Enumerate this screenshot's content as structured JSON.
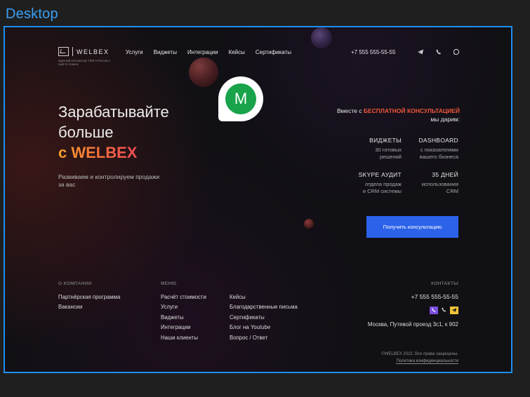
{
  "frame_label": "Desktop",
  "brand": {
    "name": "WELBEX",
    "tagline": "Крупный интегратор CRM в России и ещё 8 странах"
  },
  "nav": [
    "Услуги",
    "Виджеты",
    "Интеграции",
    "Кейсы",
    "Сертификаты"
  ],
  "header": {
    "phone": "+7 555 555-55-55",
    "icons": [
      "telegram-icon",
      "viber-icon",
      "whatsapp-icon"
    ]
  },
  "overlay_badge": {
    "letter": "M",
    "color": "#19a34a"
  },
  "hero": {
    "title_line1": "Зарабатывайте",
    "title_line2": "больше",
    "title_accent": "с WELBEX",
    "subtitle": "Развиваем и контролируем продажи за вас"
  },
  "offer": {
    "head_prefix": "Вместе с ",
    "head_highlight": "БЕСПЛАТНОЙ КОНСУЛЬТАЦИЕЙ",
    "head_suffix": " мы дарим:",
    "features": [
      {
        "title": "ВИДЖЕТЫ",
        "desc1": "30 готовых",
        "desc2": "решений"
      },
      {
        "title": "DASHBOARD",
        "desc1": "с показателями",
        "desc2": "вашего бизнеса"
      },
      {
        "title": "SKYPE АУДИТ",
        "desc1": "отдела продаж",
        "desc2": "и CRM системы"
      },
      {
        "title": "35 ДНЕЙ",
        "desc1": "использования",
        "desc2": "CRM"
      }
    ],
    "cta": "Получить консультацию"
  },
  "footer": {
    "company_head": "О КОМПАНИИ",
    "company_links": [
      "Партнёрская программа",
      "Вакансии"
    ],
    "menu_head": "МЕНЮ",
    "menu_col1": [
      "Расчёт стоимости",
      "Услуги",
      "Виджеты",
      "Интеграции",
      "Наши клиенты"
    ],
    "menu_col2": [
      "Кейсы",
      "Благодарственные письма",
      "Сертификаты",
      "Блог на Youtube",
      "Вопрос / Ответ"
    ],
    "contacts_head": "КОНТАКТЫ",
    "phone": "+7 555 555-55-55",
    "address": "Москва, Путевой проезд 3с1, к 902",
    "copyright": "©WELBEX 2022. Все права защищены.",
    "privacy": "Политика конфиденциальности",
    "colors": {
      "viber": "#7b4fe0",
      "telegram": "#f2c23a"
    }
  }
}
